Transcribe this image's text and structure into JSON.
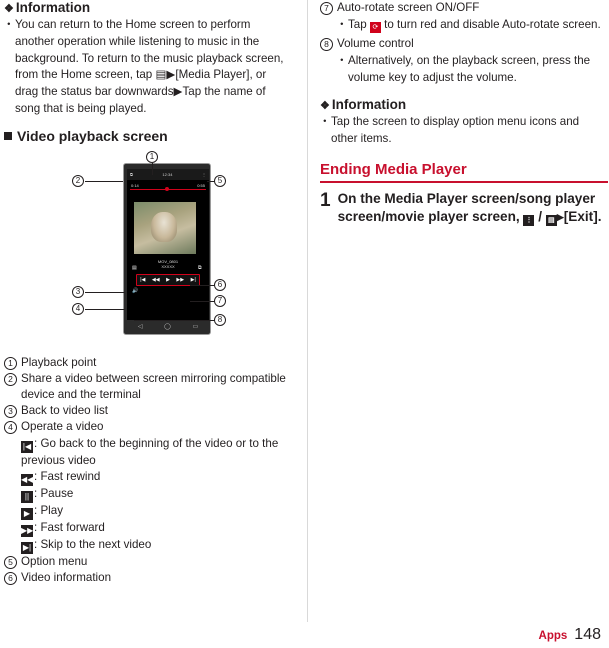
{
  "left": {
    "info_heading": "Information",
    "info_bullets": [
      "You can return to the Home screen to perform another operation while listening to music in the background. To return to the music playback screen, from the Home screen, tap ▤▶[Media Player], or drag the status bar downwards▶Tap the name of song that is being played."
    ],
    "section_heading": "Video playback screen",
    "phone": {
      "status_time": "12:34",
      "elapsed": "0:14",
      "total": "0:55",
      "title_line1": "MOV_0801",
      "title_line2": "XXXXX",
      "controls": [
        "|◀",
        "◀◀",
        "▶",
        "▶▶",
        "▶|"
      ],
      "nav": [
        "◁",
        "◯",
        "▭"
      ]
    },
    "callouts": [
      "1",
      "2",
      "3",
      "4",
      "5",
      "6",
      "7",
      "8"
    ],
    "legend": [
      {
        "num": "1",
        "text": "Playback point"
      },
      {
        "num": "2",
        "text": "Share a video between screen mirroring compatible device and the terminal"
      },
      {
        "num": "3",
        "text": "Back to video list"
      },
      {
        "num": "4",
        "text": "Operate a video"
      },
      {
        "num": "5",
        "text": "Option menu"
      },
      {
        "num": "6",
        "text": "Video information"
      }
    ],
    "operate_items": [
      {
        "icon": "|◀",
        "text": ": Go back to the beginning of the video or to the previous video"
      },
      {
        "icon": "◀◀",
        "text": ": Fast rewind"
      },
      {
        "icon": "||",
        "text": ": Pause"
      },
      {
        "icon": "▶",
        "text": ": Play"
      },
      {
        "icon": "▶▶",
        "text": ": Fast forward"
      },
      {
        "icon": "▶|",
        "text": ": Skip to the next video"
      }
    ]
  },
  "right": {
    "items": [
      {
        "num": "7",
        "title": "Auto-rotate screen ON/OFF",
        "sub": "Tap ⟳ to turn red and disable Auto-rotate screen."
      },
      {
        "num": "8",
        "title": "Volume control",
        "sub": "Alternatively, on the playback screen, press the volume key to adjust the volume."
      }
    ],
    "info_heading": "Information",
    "info_bullets": [
      "Tap the screen to display option menu icons and other items."
    ],
    "ending_heading": "Ending Media Player",
    "step": {
      "number": "1",
      "text_before": "On the Media Player screen/song player screen/movie player screen,",
      "icon_a": "⋮",
      "separator": "/",
      "icon_b": "▤",
      "arrow": "▶",
      "text_after": "[Exit]."
    }
  },
  "footer": {
    "section": "Apps",
    "page": "148"
  },
  "colors": {
    "accent_red": "#c8102e",
    "text": "#231f20",
    "rule": "#d9d9d9"
  }
}
